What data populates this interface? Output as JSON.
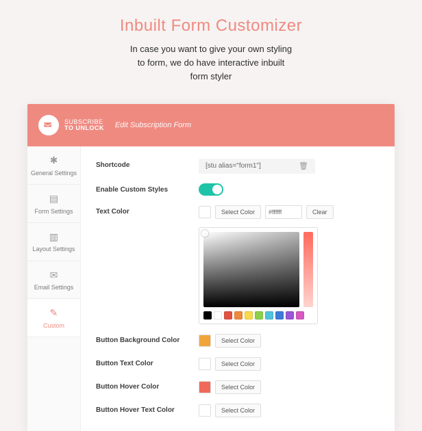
{
  "page": {
    "title": "Inbuilt Form Customizer",
    "sub1": "In case you want to give your own styling",
    "sub2": "to form, we do have interactive inbuilt",
    "sub3": "form styler"
  },
  "header": {
    "brand1": "SUBSCRIBE",
    "brand2": "TO UNLOCK",
    "subtitle": "Edit Subscription Form"
  },
  "tabs": {
    "general": "General Settings",
    "form": "Form Settings",
    "layout": "Layout Settings",
    "email": "Email Settings",
    "custom": "Custom"
  },
  "labels": {
    "shortcode": "Shortcode",
    "enable_custom": "Enable Custom Styles",
    "text_color": "Text Color",
    "btn_bg": "Button Background Color",
    "btn_text": "Button Text Color",
    "btn_hover": "Button Hover Color",
    "btn_hover_text": "Button Hover Text Color",
    "select": "Select Color",
    "clear": "Clear"
  },
  "values": {
    "shortcode": "[stu alias=\"form1\"]",
    "hex": "#ffffff"
  },
  "swatch_colors": {
    "text": "#ffffff",
    "btn_bg": "#f0a53b",
    "btn_text": "#ffffff",
    "btn_hover": "#ef6a5b",
    "btn_hover_text": "#ffffff"
  },
  "picker_presets": [
    "#000000",
    "#ffffff",
    "#e25241",
    "#ee8a3c",
    "#f7d94a",
    "#8cd04a",
    "#4fc3d9",
    "#3d7bd9",
    "#9a55d9",
    "#d957c2"
  ]
}
